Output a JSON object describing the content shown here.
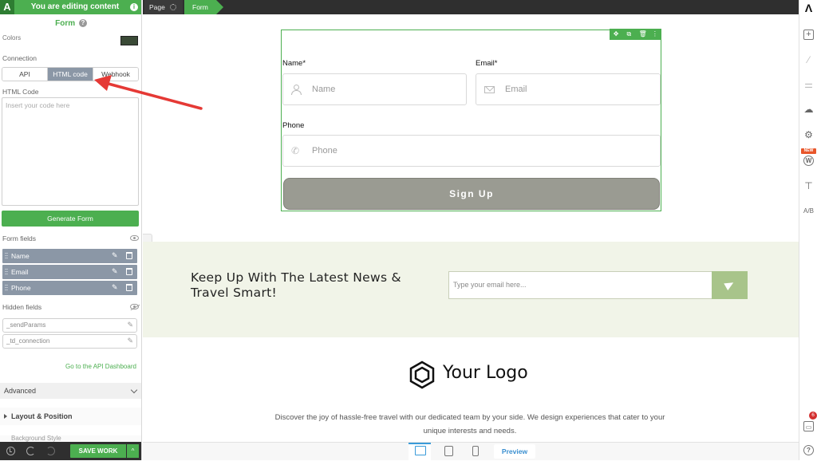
{
  "editor": {
    "logo_glyph": "A",
    "editing_banner": "You are editing content",
    "info_glyph": "i"
  },
  "left_panel": {
    "title": "Form",
    "help_glyph": "?",
    "colors_label": "Colors",
    "colors_swatch_color": "#3a4a36",
    "connection_label": "Connection",
    "connection_options": [
      "API",
      "HTML code",
      "Webhook"
    ],
    "connection_selected": "HTML code",
    "html_code_label": "HTML Code",
    "html_code_placeholder": "Insert your code here",
    "generate_button": "Generate Form",
    "form_fields_label": "Form fields",
    "form_fields": [
      "Name",
      "Email",
      "Phone"
    ],
    "hidden_fields_label": "Hidden fields",
    "hidden_fields": [
      "_sendParams",
      "_td_connection"
    ],
    "api_link": "Go to the API Dashboard",
    "advanced_label": "Advanced",
    "layout_label": "Layout & Position",
    "background_peek": "Background Style"
  },
  "bottom_left": {
    "save_label": "SAVE WORK",
    "save_arrow_glyph": "^"
  },
  "breadcrumb": {
    "page": "Page",
    "form": "Form"
  },
  "form": {
    "tools": [
      "✥",
      "⧉",
      "🗑",
      "⋮"
    ],
    "name_label": "Name*",
    "name_placeholder": "Name",
    "email_label": "Email*",
    "email_placeholder": "Email",
    "phone_label": "Phone",
    "phone_placeholder": "Phone",
    "phone_icon_glyph": "✆",
    "submit_label": "Sign Up"
  },
  "newsletter": {
    "title": "Keep Up With The Latest News & Travel Smart!",
    "email_placeholder": "Type your email here..."
  },
  "footer": {
    "logo_text": "Your Logo",
    "tagline": "Discover the joy of hassle-free travel with our dedicated team by your side. We design experiences that cater to your unique interests and needs."
  },
  "device_bar": {
    "preview_label": "Preview"
  },
  "right_toolbar": {
    "logo_glyph": "Λ",
    "plus_glyph": "+",
    "link_glyph": "⁄",
    "sliders_glyph": "⚌",
    "cloud_glyph": "☁",
    "gear_glyph": "⚙",
    "new_badge": "NEW",
    "wp_glyph": "W",
    "text_glyph": "⊤",
    "ab_glyph": "A/B",
    "inbox_glyph": "▭",
    "notification_count": "6",
    "help_glyph": "?"
  },
  "colors": {
    "accent_green": "#4caf50",
    "selected_gray": "#8b97a6",
    "button_gray": "#9a9b92",
    "newsletter_bg": "#f1f4e8",
    "send_green": "#a8c48a",
    "annotation_red": "#e53935"
  }
}
